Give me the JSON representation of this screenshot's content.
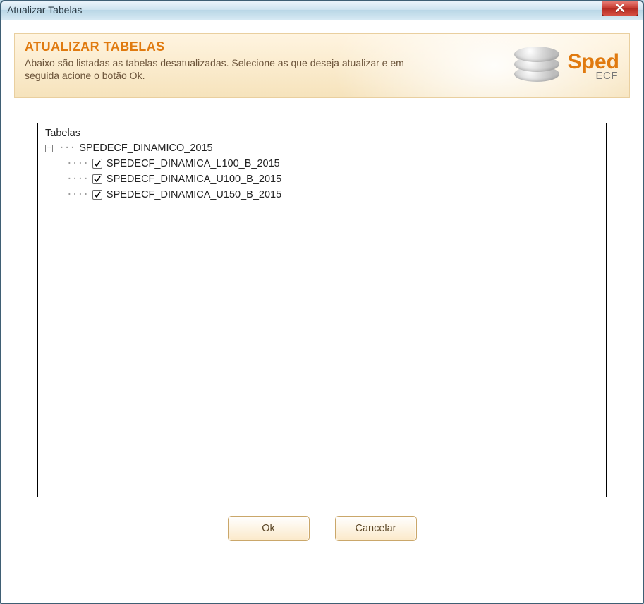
{
  "window": {
    "title": "Atualizar Tabelas"
  },
  "header": {
    "title": "ATUALIZAR TABELAS",
    "description": "Abaixo são listadas as tabelas desatualizadas. Selecione as que deseja atualizar e em seguida acione o botão Ok."
  },
  "logo": {
    "brand": "Sped",
    "sub": "ECF"
  },
  "tree": {
    "root_label": "Tabelas",
    "group": {
      "label": "SPEDECF_DINAMICO_2015",
      "items": [
        {
          "label": "SPEDECF_DINAMICA_L100_B_2015",
          "checked": true
        },
        {
          "label": "SPEDECF_DINAMICA_U100_B_2015",
          "checked": true
        },
        {
          "label": "SPEDECF_DINAMICA_U150_B_2015",
          "checked": true
        }
      ]
    }
  },
  "buttons": {
    "ok": "Ok",
    "cancel": "Cancelar"
  },
  "expander_glyph": "−"
}
